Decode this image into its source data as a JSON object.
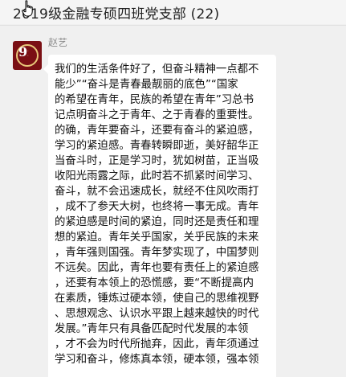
{
  "window": {
    "title": "2019级金融专硕四班党支部 (22)"
  },
  "message": {
    "sender": "赵艺",
    "avatar_icon": "ninety-ninth-anniversary-badge-icon",
    "avatar_digit": "9",
    "lines": [
      "我们的生活条件好了，但奋斗精神一点都不",
      "能少”“奋斗是青春最靓丽的底色”“国家",
      "的希望在青年，民族的希望在青年”习总书",
      "记点明奋斗之于青年、之于青春的重要性。",
      "的确，青年要奋斗，还要有奋斗的紧迫感，",
      "学习的紧迫感。青春转瞬即逝，美好韶华正",
      "当奋斗时，正是学习时，犹如树苗，正当吸",
      "收阳光雨露之际，此时若不抓紧时间学习、",
      "奋斗，就不会迅速成长，就经不住风吹雨打",
      "，成不了参天大树，也终将一事无成。青年",
      "的紧迫感是时间的紧迫，同时还是责任和理",
      "想的紧迫。青年关乎国家，关乎民族的未来",
      "，青年强则国强。青年梦实现了，中国梦则",
      "不远矣。因此，青年也要有责任上的紧迫感",
      "，还要有本领上的恐慌感，要“不断提高内",
      "在素质，锤炼过硬本领，使自己的思维视野",
      "、思想观念、认识水平跟上越来越快的时代",
      "发展。”青年只有具备匹配时代发展的本领",
      "，才不会为时代所抛弃，因此，青年须通过",
      "学习和奋斗，修炼真本领，硬本领，强本领"
    ]
  },
  "colors": {
    "background": "#f0f0f0",
    "bubble": "#ffffff",
    "avatar_bg": "#7a0f14",
    "avatar_ring": "#e8c77a"
  }
}
